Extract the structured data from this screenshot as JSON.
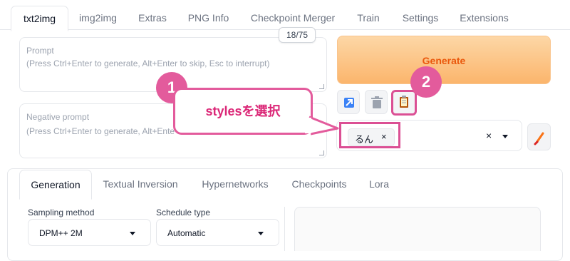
{
  "top_tabs": [
    "txt2img",
    "img2img",
    "Extras",
    "PNG Info",
    "Checkpoint Merger",
    "Train",
    "Settings",
    "Extensions"
  ],
  "prompt": {
    "label": "Prompt",
    "placeholder": "(Press Ctrl+Enter to generate, Alt+Enter to skip, Esc to interrupt)",
    "token_counter": "18/75"
  },
  "negative_prompt": {
    "label": "Negative prompt",
    "placeholder": "(Press Ctrl+Enter to generate, Alt+Ente"
  },
  "generate_label": "Generate",
  "styles": {
    "selected": "るん",
    "remove_glyph": "×",
    "clear_glyph": "×"
  },
  "annotations": {
    "step1": "1",
    "step2": "2",
    "bubble_text": "stylesを選択"
  },
  "bottom_tabs": [
    "Generation",
    "Textual Inversion",
    "Hypernetworks",
    "Checkpoints",
    "Lora"
  ],
  "sampling": {
    "method_label": "Sampling method",
    "method_value": "DPM++ 2M",
    "schedule_label": "Schedule type",
    "schedule_value": "Automatic"
  },
  "colors": {
    "accent_orange": "#ea580c",
    "annotation_pink": "#e35b9c"
  },
  "icons": [
    "send-to-icon",
    "trash-icon",
    "clipboard-icon",
    "paintbrush-icon",
    "resize-handle-icon"
  ]
}
